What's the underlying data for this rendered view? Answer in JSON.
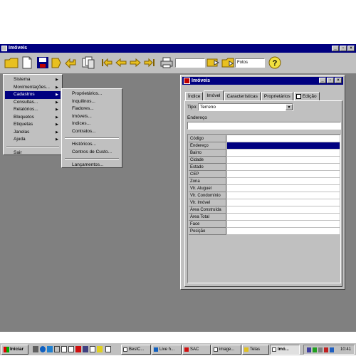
{
  "app": {
    "title": "Imóveis"
  },
  "window_buttons": {
    "minimize": "_",
    "restore": "▫",
    "close": "×"
  },
  "toolbar": {
    "search_value": "",
    "fotos_label": "Fotos",
    "help_label": "?"
  },
  "main_menu": {
    "items": [
      {
        "label": "Sistema",
        "arrow": "▶"
      },
      {
        "label": "Movimentações...",
        "arrow": "▶"
      },
      {
        "label": "Cadastros",
        "arrow": "▶"
      },
      {
        "label": "Consultas...",
        "arrow": "▶"
      },
      {
        "label": "Relatórios...",
        "arrow": "▶"
      },
      {
        "label": "Bloquetos",
        "arrow": "▶"
      },
      {
        "label": "Etiquetas",
        "arrow": "▶"
      },
      {
        "label": "Janelas",
        "arrow": "▶"
      },
      {
        "label": "Ajuda",
        "arrow": "▶"
      },
      {
        "label": "Sair"
      }
    ]
  },
  "cadastros_menu": {
    "items": [
      "Proprietários...",
      "Inquilinos...",
      "Fiadores...",
      "Imóveis...",
      "Indices...",
      "Contratos...",
      "Históricos...",
      "Centros de Custo...",
      "Lançamentos..."
    ]
  },
  "child_window": {
    "title": "Imóveis",
    "tabs": [
      "Índice",
      "Imóvel",
      "Características",
      "Proprietários",
      "Edição"
    ],
    "tipo_label": "Tipo:",
    "tipo_value": "Terreno",
    "endereco_label": "Endereço",
    "endereco_value": "",
    "grid_rows": [
      "Código",
      "Endereço",
      "Bairro",
      "Cidade",
      "Estado",
      "CEP",
      "Zona",
      "Vlr. Aluguel",
      "Vlr. Condomínio",
      "Vlr. Imóvel",
      "Área Construída",
      "Área Total",
      "Face",
      "Posição"
    ]
  },
  "taskbar": {
    "start_label": "Iniciar",
    "tasks": [
      "BestC...",
      "Live h...",
      "SAC",
      "image...",
      "Telas",
      "Imó..."
    ],
    "clock": "10:41"
  }
}
